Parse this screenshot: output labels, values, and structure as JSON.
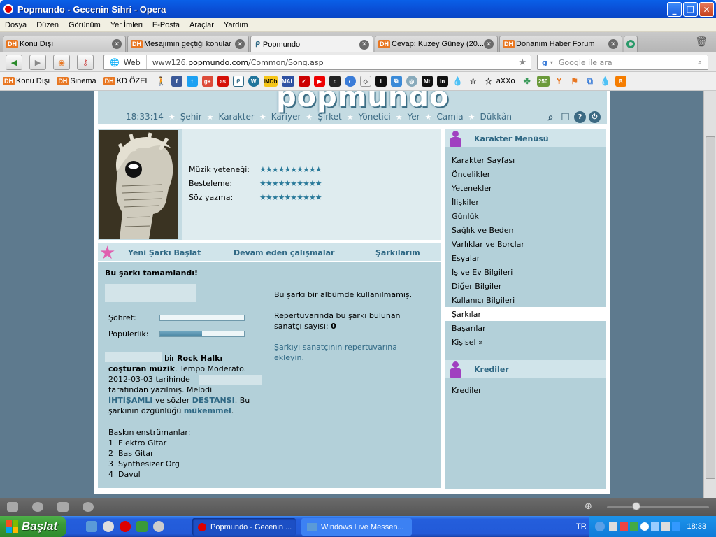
{
  "window": {
    "title": "Popmundo - Gecenin Sihri - Opera"
  },
  "menu": [
    "Dosya",
    "Düzen",
    "Görünüm",
    "Yer İmleri",
    "E-Posta",
    "Araçlar",
    "Yardım"
  ],
  "tabs": [
    {
      "label": "Konu Dışı",
      "badge": "DH"
    },
    {
      "label": "Mesajımın geçtiği konular",
      "badge": "DH"
    },
    {
      "label": "Popmundo",
      "badge": ""
    },
    {
      "label": "Cevap: Kuzey Güney (20...",
      "badge": "DH"
    },
    {
      "label": "Donanım Haber Forum",
      "badge": "DH"
    }
  ],
  "address": {
    "mode": "Web",
    "url_prefix": "www126.",
    "url_domain": "popmundo.com",
    "url_path": "/Common/Song.asp",
    "search_placeholder": "Google ile ara"
  },
  "bookmarks": [
    {
      "label": "Konu Dışı",
      "badge": "DH"
    },
    {
      "label": "Sinema",
      "badge": "DH"
    },
    {
      "label": "KD ÖZEL",
      "badge": "DH"
    },
    {
      "label": "aXXo",
      "badge": ""
    }
  ],
  "site": {
    "logo": "popmundo",
    "time": "18:33:14",
    "nav": [
      "Şehir",
      "Karakter",
      "Kariyer",
      "Şirket",
      "Yönetici",
      "Yer",
      "Camia",
      "Dükkân"
    ]
  },
  "skills": [
    {
      "label": "Müzik yeteneği:",
      "stars": "★★★★★★★★★★"
    },
    {
      "label": "Besteleme:",
      "stars": "★★★★★★★★★★"
    },
    {
      "label": "Söz yazma:",
      "stars": "★★★★★★★★★★"
    }
  ],
  "song_tabs": [
    "Yeni Şarkı Başlat",
    "Devam eden çalışmalar",
    "Şarkılarım"
  ],
  "song": {
    "status": "Bu şarkı tamamlandı!",
    "fame_label": "Şöhret:",
    "popularity_label": "Popülerlik:",
    "fame": 0,
    "popularity": 0.5,
    "desc_1": "bir",
    "genre": "Rock Halkı",
    "desc_2": "coşturan müzik",
    "desc_3": ". Tempo Moderato.",
    "date": "2012-03-03",
    "desc_4": "tarihinde",
    "desc_5": "tarafından yazılmış. Melodi",
    "melody": "İHTİŞAMLI",
    "desc_6": "ve sözler",
    "lyrics": "DESTANSI",
    "desc_7": ". Bu şarkının özgünlüğü",
    "originality": "mükemmel",
    "desc_8": ".",
    "instr_title": "Baskın enstrümanlar:",
    "instruments": [
      "1  Elektro Gitar",
      "2  Bas Gitar",
      "3  Synthesizer Org",
      "4  Davul"
    ],
    "album_note": "Bu şarkı bir albümde kullanılmamış.",
    "rep_note": "Repertuvarında bu şarkı bulunan sanatçı sayısı:",
    "rep_count": "0",
    "rep_link": "Şarkıyı sanatçının repertuvarına ekleyin."
  },
  "sidebar": {
    "menu_title": "Karakter Menüsü",
    "items": [
      "Karakter Sayfası",
      "Öncelikler",
      "Yetenekler",
      "İlişkiler",
      "Günlük",
      "Sağlık ve Beden",
      "Varlıklar ve Borçlar",
      "Eşyalar",
      "İş ve Ev Bilgileri",
      "Diğer Bilgiler",
      "Kullanıcı Bilgileri",
      "Şarkılar",
      "Başarılar",
      "Kişisel »"
    ],
    "active_item": "Şarkılar",
    "credits_title": "Krediler",
    "credits_items": [
      "Krediler"
    ]
  },
  "taskbar": {
    "start": "Başlat",
    "tasks": [
      "Popmundo - Gecenin ...",
      "Windows Live Messen..."
    ],
    "lang": "TR",
    "clock": "18:33"
  }
}
